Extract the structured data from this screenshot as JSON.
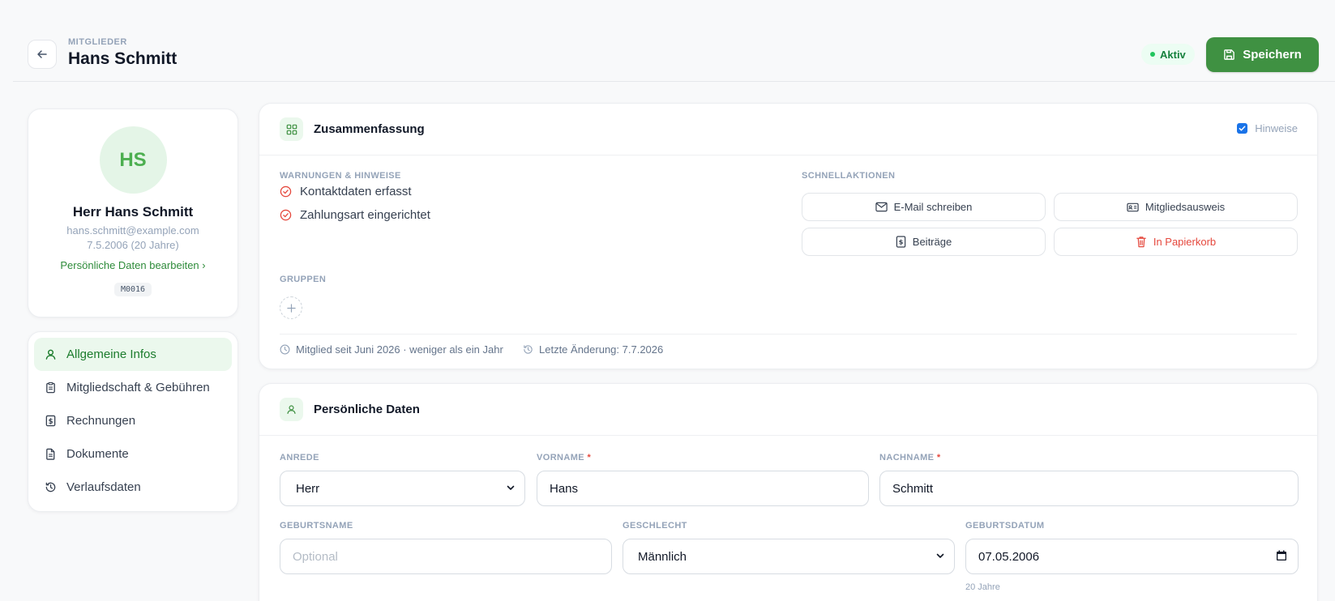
{
  "header": {
    "eyebrow": "MITGLIEDER",
    "title": "Hans Schmitt",
    "status": "Aktiv",
    "save_label": "Speichern"
  },
  "profile": {
    "initials": "HS",
    "name": "Herr Hans Schmitt",
    "email": "hans.schmitt@example.com",
    "birth": "7.5.2006 (20 Jahre)",
    "edit_link": "Persönliche Daten bearbeiten ›",
    "member_id": "M0016"
  },
  "nav": {
    "items": [
      {
        "label": "Allgemeine Infos",
        "icon": "user-icon",
        "active": true
      },
      {
        "label": "Mitgliedschaft & Gebühren",
        "icon": "clipboard-icon"
      },
      {
        "label": "Rechnungen",
        "icon": "receipt-icon"
      },
      {
        "label": "Dokumente",
        "icon": "document-icon"
      },
      {
        "label": "Verlaufsdaten",
        "icon": "history-icon"
      }
    ]
  },
  "summary": {
    "title": "Zusammenfassung",
    "hint_label": "Hinweise",
    "hint_checked": true,
    "warnings_label": "WARNUNGEN & HINWEISE",
    "warnings": [
      "Kontaktdaten erfasst",
      "Zahlungsart eingerichtet"
    ],
    "quick_label": "SCHNELLAKTIONEN",
    "quick_actions": {
      "email": "E-Mail schreiben",
      "card": "Mitgliedsausweis",
      "fees": "Beiträge",
      "trash": "In Papierkorb"
    },
    "groups_label": "GRUPPEN",
    "member_since": "Mitglied seit Juni 2026 · weniger als ein Jahr",
    "last_change": "Letzte Änderung: 7.7.2026"
  },
  "personal": {
    "title": "Persönliche Daten",
    "salutation": {
      "label": "ANREDE",
      "value": "Herr"
    },
    "firstname": {
      "label": "VORNAME",
      "value": "Hans"
    },
    "lastname": {
      "label": "NACHNAME",
      "value": "Schmitt"
    },
    "birthname": {
      "label": "GEBURTSNAME",
      "placeholder": "Optional"
    },
    "gender": {
      "label": "GESCHLECHT",
      "value": "Männlich"
    },
    "birthdate": {
      "label": "GEBURTSDATUM",
      "value": "07.05.2006",
      "hint": "20 Jahre"
    },
    "required_mark": "*"
  },
  "colors": {
    "accent": "#3f9142",
    "danger": "#e5483d",
    "active_bg": "#ebf8ed"
  }
}
